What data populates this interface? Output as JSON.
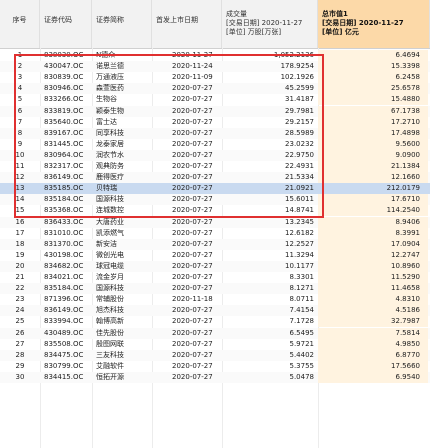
{
  "headers": {
    "seq": "序号",
    "code": "证券代码",
    "name": "证券简称",
    "list_date": "首发上市日期",
    "volume_l1": "成交量",
    "volume_l2": "[交易日期] 2020-11-27",
    "volume_l3": "[单位] 万股[万张]",
    "mktcap_l1": "总市值1",
    "mktcap_l2": "[交易日期] 2020-11-27",
    "mktcap_l3": "[单位] 亿元"
  },
  "selected_row": 13,
  "rows": [
    {
      "seq": "1",
      "code": "838030.OC",
      "name": "N德众",
      "date": "2020-11-27",
      "volume": "1,052.2136",
      "cap": "6.4694"
    },
    {
      "seq": "2",
      "code": "430047.OC",
      "name": "诺思兰德",
      "date": "2020-11-24",
      "volume": "178.9254",
      "cap": "15.3398"
    },
    {
      "seq": "3",
      "code": "830839.OC",
      "name": "万通液压",
      "date": "2020-11-09",
      "volume": "102.1926",
      "cap": "6.2458"
    },
    {
      "seq": "4",
      "code": "830946.OC",
      "name": "森萱医药",
      "date": "2020-07-27",
      "volume": "45.2599",
      "cap": "25.6578"
    },
    {
      "seq": "5",
      "code": "833266.OC",
      "name": "生物谷",
      "date": "2020-07-27",
      "volume": "31.4187",
      "cap": "15.4880"
    },
    {
      "seq": "6",
      "code": "833819.OC",
      "name": "颖泰生物",
      "date": "2020-07-27",
      "volume": "29.7981",
      "cap": "67.1738"
    },
    {
      "seq": "7",
      "code": "835640.OC",
      "name": "富士达",
      "date": "2020-07-27",
      "volume": "29.2157",
      "cap": "17.2710"
    },
    {
      "seq": "8",
      "code": "839167.OC",
      "name": "同享科技",
      "date": "2020-07-27",
      "volume": "28.5989",
      "cap": "17.4898"
    },
    {
      "seq": "9",
      "code": "831445.OC",
      "name": "龙泰家居",
      "date": "2020-07-27",
      "volume": "23.0232",
      "cap": "9.5600"
    },
    {
      "seq": "10",
      "code": "830964.OC",
      "name": "润农节水",
      "date": "2020-07-27",
      "volume": "22.9750",
      "cap": "9.0900"
    },
    {
      "seq": "11",
      "code": "832317.OC",
      "name": "观典防务",
      "date": "2020-07-27",
      "volume": "22.4931",
      "cap": "21.1384"
    },
    {
      "seq": "12",
      "code": "836149.OC",
      "name": "鹿得医疗",
      "date": "2020-07-27",
      "volume": "21.5334",
      "cap": "12.1660"
    },
    {
      "seq": "13",
      "code": "835185.OC",
      "name": "贝特瑞",
      "date": "2020-07-27",
      "volume": "21.0921",
      "cap": "212.0179"
    },
    {
      "seq": "14",
      "code": "835184.OC",
      "name": "国源科技",
      "date": "2020-07-27",
      "volume": "15.6011",
      "cap": "17.6710"
    },
    {
      "seq": "15",
      "code": "835368.OC",
      "name": "连城数控",
      "date": "2020-07-27",
      "volume": "14.8741",
      "cap": "114.2540"
    },
    {
      "seq": "16",
      "code": "836433.OC",
      "name": "大唐药业",
      "date": "2020-07-27",
      "volume": "13.2345",
      "cap": "8.9406"
    },
    {
      "seq": "17",
      "code": "831010.OC",
      "name": "凯添燃气",
      "date": "2020-07-27",
      "volume": "12.6182",
      "cap": "8.3991"
    },
    {
      "seq": "18",
      "code": "831370.OC",
      "name": "新安洁",
      "date": "2020-07-27",
      "volume": "12.2527",
      "cap": "17.0904"
    },
    {
      "seq": "19",
      "code": "430198.OC",
      "name": "微创光电",
      "date": "2020-07-27",
      "volume": "11.3294",
      "cap": "12.2747"
    },
    {
      "seq": "20",
      "code": "834682.OC",
      "name": "球冠电缆",
      "date": "2020-07-27",
      "volume": "10.1177",
      "cap": "10.8960"
    },
    {
      "seq": "21",
      "code": "834021.OC",
      "name": "流金岁月",
      "date": "2020-07-27",
      "volume": "8.3301",
      "cap": "11.5290"
    },
    {
      "seq": "22",
      "code": "835184.OC",
      "name": "国源科技",
      "date": "2020-07-27",
      "volume": "8.1271",
      "cap": "11.4658"
    },
    {
      "seq": "23",
      "code": "871396.OC",
      "name": "常辅股份",
      "date": "2020-11-18",
      "volume": "8.0711",
      "cap": "4.8310"
    },
    {
      "seq": "24",
      "code": "836149.OC",
      "name": "旭杰科技",
      "date": "2020-07-27",
      "volume": "7.4154",
      "cap": "4.5186"
    },
    {
      "seq": "25",
      "code": "833994.OC",
      "name": "翰博高新",
      "date": "2020-07-27",
      "volume": "7.1728",
      "cap": "32.7987"
    },
    {
      "seq": "26",
      "code": "430489.OC",
      "name": "佳先股份",
      "date": "2020-07-27",
      "volume": "6.5495",
      "cap": "7.5814"
    },
    {
      "seq": "27",
      "code": "835508.OC",
      "name": "殷图网联",
      "date": "2020-07-27",
      "volume": "5.9721",
      "cap": "4.9850"
    },
    {
      "seq": "28",
      "code": "834475.OC",
      "name": "三友科技",
      "date": "2020-07-27",
      "volume": "5.4402",
      "cap": "6.8770"
    },
    {
      "seq": "29",
      "code": "830799.OC",
      "name": "艾融软件",
      "date": "2020-07-27",
      "volume": "5.3755",
      "cap": "17.5660"
    },
    {
      "seq": "30",
      "code": "834415.OC",
      "name": "恒拓开源",
      "date": "2020-07-27",
      "volume": "5.0478",
      "cap": "6.9540"
    }
  ]
}
